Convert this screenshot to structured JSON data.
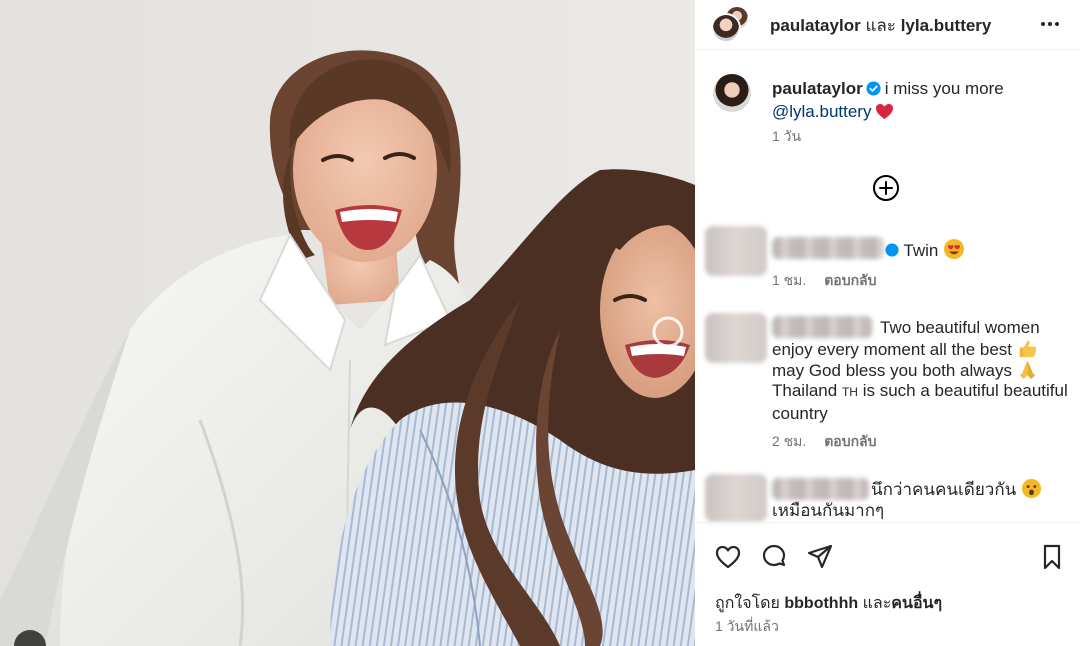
{
  "header": {
    "user1": "paulataylor",
    "joiner": "และ",
    "user2": "lyla.buttery"
  },
  "caption": {
    "username": "paulataylor",
    "text": "i miss you more",
    "mention": "@lyla.buttery",
    "time": "1 วัน"
  },
  "comments": [
    {
      "text": "Twin",
      "time": "1 ชม.",
      "reply": "ตอบกลับ"
    },
    {
      "text": "Two beautiful women enjoy every moment all the best",
      "line2": "may God bless you both always",
      "line3": "Thailand",
      "flag_text": "TH",
      "line4": "is such a beautiful beautiful country",
      "time": "2 ชม.",
      "reply": "ตอบกลับ"
    },
    {
      "text": "นึกว่าคนคนเดียวกัน",
      "line2": "เหมือนกันมากๆ"
    }
  ],
  "footer": {
    "likes_prefix": "ถูกใจโดย",
    "likes_user": "bbbothhh",
    "likes_joiner": "และ",
    "likes_others": "คนอื่นๆ",
    "time": "1 วันที่แล้ว"
  },
  "icons": {
    "more": "more-options-icon",
    "load_more": "plus-circle-icon",
    "like": "heart-outline-icon",
    "comment": "comment-icon",
    "share": "paper-plane-icon",
    "save": "bookmark-icon"
  },
  "colors": {
    "verified": "#0095f6",
    "mention": "#00376b",
    "heart_emoji": "#d7263d",
    "muted_text": "#737373"
  }
}
